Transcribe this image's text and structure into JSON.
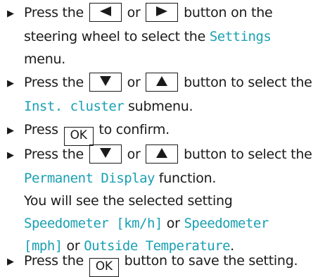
{
  "colors": {
    "text": "#1a1a1a",
    "display_text": "#1aa0b3"
  },
  "bullet_icon": "right-triangle-bullet",
  "steps": [
    {
      "l1_a": "Press the",
      "btn_left_icon": "left-arrow-button",
      "l1_or": "or",
      "btn_right_icon": "right-arrow-button",
      "l1_b": "button on the",
      "l2_a": "steering wheel to select the",
      "l2_menu": "Settings",
      "l3": "menu."
    },
    {
      "l1_a": "Press the",
      "btn_down_icon": "down-arrow-button",
      "l1_or": "or",
      "btn_up_icon": "up-arrow-button",
      "l1_b": "button to select the",
      "l2_menu": "Inst. cluster",
      "l2_b": "submenu."
    },
    {
      "l1_a": "Press",
      "btn_ok": "OK",
      "l1_b": "to confirm."
    },
    {
      "l1_a": "Press the",
      "btn_down_icon": "down-arrow-button",
      "l1_or": "or",
      "btn_up_icon": "up-arrow-button",
      "l1_b": "button to select the",
      "l2_func": "Permanent Display",
      "l2_b": "function.",
      "l3": "You will see the selected setting",
      "l4_opt1": "Speedometer [km/h]",
      "l4_or": "or",
      "l4_opt2_a": "Speedometer",
      "l5_opt2_b": "[mph]",
      "l5_or": "or",
      "l5_opt3": "Outside Temperature",
      "l5_end": "."
    },
    {
      "l1_a": "Press the",
      "btn_ok": "OK",
      "l1_b": "button to save the setting."
    }
  ]
}
